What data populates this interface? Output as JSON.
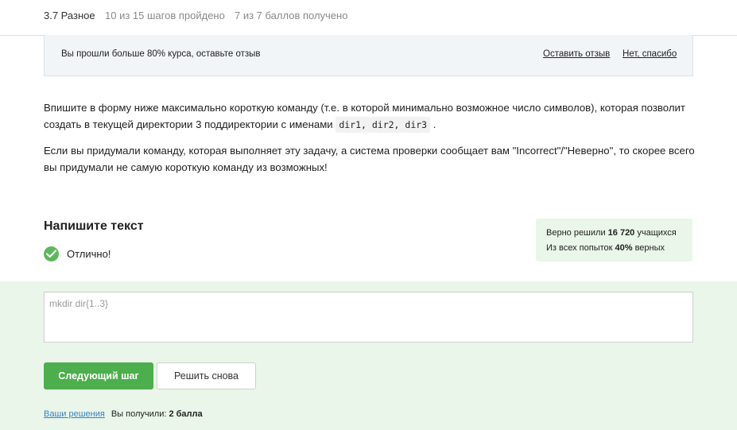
{
  "header": {
    "breadcrumb": "3.7 Разное",
    "steps": "10 из 15 шагов пройдено",
    "points": "7 из 7 баллов  получено"
  },
  "banner": {
    "message": "Вы прошли больше 80% курса, оставьте отзыв",
    "review_link": "Оставить отзыв",
    "no_thanks_link": "Нет, спасибо"
  },
  "task": {
    "p1_before": "Впишите в форму ниже максимально короткую команду (т.е. в которой минимально возможное число символов), которая позволит создать в текущей директории 3 поддиректории с именами ",
    "p1_code": "dir1, dir2, dir3",
    "p1_after": " .",
    "p2": "Если вы придумали команду, которая выполняет эту задачу, а система проверки сообщает вам \"Incorrect\"/\"Неверно\", то скорее всего вы придумали не самую короткую команду из возможных!"
  },
  "answer_block": {
    "heading": "Напишите текст",
    "status": "Отлично!",
    "answer_text": "mkdir dir{1..3}"
  },
  "stats": {
    "r1_prefix": "Верно решили ",
    "r1_value": "16 720",
    "r1_suffix": " учащихся",
    "r2_prefix": "Из всех попыток ",
    "r2_value": "40%",
    "r2_suffix": " верных"
  },
  "buttons": {
    "next": "Следующий шаг",
    "retry": "Решить снова"
  },
  "footer": {
    "your_solutions": "Ваши решения",
    "received_prefix": "Вы получили: ",
    "received_value": "2 балла"
  },
  "colors": {
    "accent_green": "#4cae4c",
    "success_bg": "#e9f6e9",
    "banner_bg": "#f1f5f8",
    "link_blue": "#3d7fc1"
  },
  "icons": {
    "status": "check-circle-icon"
  }
}
